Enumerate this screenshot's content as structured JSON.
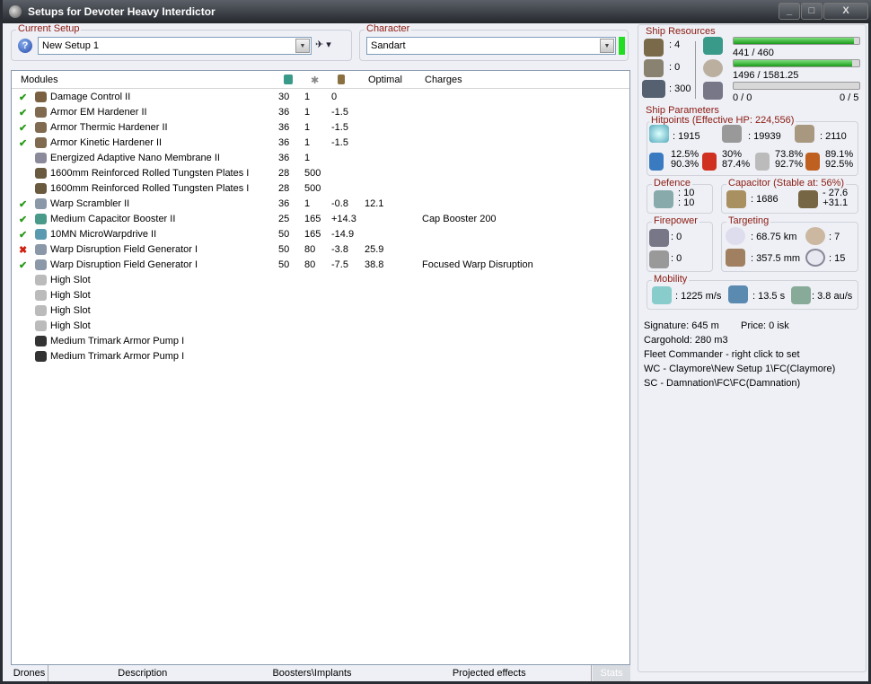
{
  "window": {
    "title": "Setups for Devoter Heavy Interdictor",
    "min": "_",
    "max": "□",
    "close": "X"
  },
  "current_setup": {
    "label": "Current Setup",
    "value": "New Setup 1"
  },
  "character": {
    "label": "Character",
    "value": "Sandart",
    "status_color": "#22dd22"
  },
  "modules": {
    "headers": [
      "Modules",
      "Optimal",
      "Charges"
    ],
    "rows": [
      {
        "state": "on",
        "name": "Damage Control II",
        "cpu": "30",
        "pg": "1",
        "cap": "0",
        "optimal": "",
        "charges": ""
      },
      {
        "state": "on",
        "name": "Armor EM Hardener II",
        "cpu": "36",
        "pg": "1",
        "cap": "-1.5",
        "optimal": "",
        "charges": ""
      },
      {
        "state": "on",
        "name": "Armor Thermic Hardener II",
        "cpu": "36",
        "pg": "1",
        "cap": "-1.5",
        "optimal": "",
        "charges": ""
      },
      {
        "state": "on",
        "name": "Armor Kinetic Hardener II",
        "cpu": "36",
        "pg": "1",
        "cap": "-1.5",
        "optimal": "",
        "charges": ""
      },
      {
        "state": "",
        "name": "Energized Adaptive Nano Membrane II",
        "cpu": "36",
        "pg": "1",
        "cap": "",
        "optimal": "",
        "charges": ""
      },
      {
        "state": "",
        "name": "1600mm Reinforced Rolled Tungsten Plates I",
        "cpu": "28",
        "pg": "500",
        "cap": "",
        "optimal": "",
        "charges": ""
      },
      {
        "state": "",
        "name": "1600mm Reinforced Rolled Tungsten Plates I",
        "cpu": "28",
        "pg": "500",
        "cap": "",
        "optimal": "",
        "charges": ""
      },
      {
        "state": "on",
        "name": "Warp Scrambler II",
        "cpu": "36",
        "pg": "1",
        "cap": "-0.8",
        "optimal": "12.1",
        "charges": ""
      },
      {
        "state": "on",
        "name": "Medium Capacitor Booster II",
        "cpu": "25",
        "pg": "165",
        "cap": "+14.3",
        "optimal": "",
        "charges": "Cap Booster 200"
      },
      {
        "state": "on",
        "name": "10MN MicroWarpdrive II",
        "cpu": "50",
        "pg": "165",
        "cap": "-14.9",
        "optimal": "",
        "charges": ""
      },
      {
        "state": "off",
        "name": "Warp Disruption Field Generator I",
        "cpu": "50",
        "pg": "80",
        "cap": "-3.8",
        "optimal": "25.9",
        "charges": ""
      },
      {
        "state": "on",
        "name": "Warp Disruption Field Generator I",
        "cpu": "50",
        "pg": "80",
        "cap": "-7.5",
        "optimal": "38.8",
        "charges": "Focused Warp Disruption"
      },
      {
        "state": "",
        "name": "High Slot",
        "cpu": "",
        "pg": "",
        "cap": "",
        "optimal": "",
        "charges": ""
      },
      {
        "state": "",
        "name": "High Slot",
        "cpu": "",
        "pg": "",
        "cap": "",
        "optimal": "",
        "charges": ""
      },
      {
        "state": "",
        "name": "High Slot",
        "cpu": "",
        "pg": "",
        "cap": "",
        "optimal": "",
        "charges": ""
      },
      {
        "state": "",
        "name": "High Slot",
        "cpu": "",
        "pg": "",
        "cap": "",
        "optimal": "",
        "charges": ""
      },
      {
        "state": "",
        "name": "Medium Trimark Armor Pump I",
        "cpu": "",
        "pg": "",
        "cap": "",
        "optimal": "",
        "charges": ""
      },
      {
        "state": "",
        "name": "Medium Trimark Armor Pump I",
        "cpu": "",
        "pg": "",
        "cap": "",
        "optimal": "",
        "charges": ""
      }
    ]
  },
  "tabs": [
    "Drones",
    "Description",
    "Boosters\\Implants",
    "Projected effects",
    "Stats"
  ],
  "resources": {
    "label": "Ship Resources",
    "turrets": ": 4",
    "launchers": ": 0",
    "calibration": ": 300",
    "cpu": "441 / 460",
    "cpu_frac": 0.959,
    "pg": "1496 / 1581.25",
    "pg_frac": 0.946,
    "drone_bw": "0 / 0",
    "drone_frac": 0.0,
    "drones": "0 / 5"
  },
  "params": {
    "label": "Ship Parameters",
    "hp_label": "Hitpoints (Effective HP: 224,556)",
    "shield": ": 1915",
    "armor": ": 19939",
    "hull": ": 2110",
    "resists": [
      [
        "12.5%",
        "90.3%"
      ],
      [
        "30%",
        "87.4%"
      ],
      [
        "73.8%",
        "92.7%"
      ],
      [
        "89.1%",
        "92.5%"
      ]
    ],
    "defence_label": "Defence",
    "def1": ": 10",
    "def2": ": 10",
    "cap_label": "Capacitor (Stable at: 56%)",
    "cap": ": 1686",
    "cap_use": "- 27.6",
    "cap_regen": "+31.1",
    "fire_label": "Firepower",
    "fire1": ": 0",
    "fire2": ": 0",
    "tgt_label": "Targeting",
    "range": ": 68.75 km",
    "targets": ": 7",
    "scan": ": 357.5 mm",
    "sensor": ": 15",
    "mob_label": "Mobility",
    "speed": ": 1225 m/s",
    "align": ": 13.5 s",
    "warp": ": 3.8 au/s"
  },
  "info": {
    "signature": "Signature: 645 m",
    "price": "Price: 0 isk",
    "cargo": "Cargohold: 280 m3",
    "fc": "Fleet Commander - right click to set",
    "wc": "WC - Claymore\\New Setup 1\\FC(Claymore)",
    "sc": "SC - Damnation\\FC\\FC(Damnation)"
  }
}
